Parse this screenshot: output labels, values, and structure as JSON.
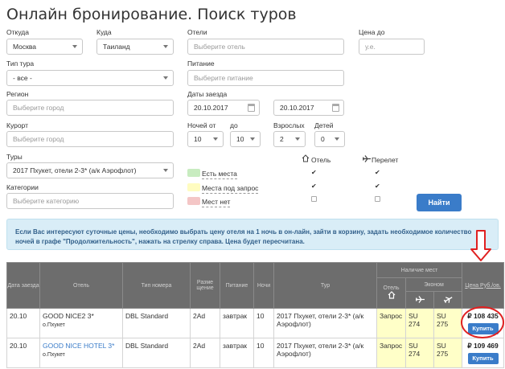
{
  "page_title": "Онлайн бронирование. Поиск туров",
  "form": {
    "from_label": "Откуда",
    "from_value": "Москва",
    "to_label": "Куда",
    "to_value": "Таиланд",
    "hotels_label": "Отели",
    "hotels_placeholder": "Выберите отель",
    "price_to_label": "Цена до",
    "price_to_placeholder": "у.е.",
    "tour_type_label": "Тип тура",
    "tour_type_value": "- все -",
    "meals_label": "Питание",
    "meals_placeholder": "Выберите питание",
    "region_label": "Регион",
    "region_placeholder": "Выберите город",
    "dates_label": "Даты заезда",
    "date_from": "20.10.2017",
    "date_to": "20.10.2017",
    "resort_label": "Курорт",
    "resort_placeholder": "Выберите город",
    "nights_from_label": "Ночей от",
    "nights_from_value": "10",
    "nights_to_label": "до",
    "nights_to_value": "10",
    "adults_label": "Взрослых",
    "adults_value": "2",
    "children_label": "Детей",
    "children_value": "0",
    "tours_label": "Туры",
    "tours_value": "2017 Пхукет, отели 2-3* (а/к Аэрофлот)",
    "categories_label": "Категории",
    "categories_placeholder": "Выберите категорию",
    "legend": [
      {
        "text": "Есть места",
        "color": "#c8ecc0"
      },
      {
        "text": "Места под запрос",
        "color": "#fffcc0"
      },
      {
        "text": "Мест нет",
        "color": "#f4c6c6"
      }
    ],
    "hotel_col_label": "Отель",
    "flight_col_label": "Перелет",
    "hotel_checks": [
      "✔",
      "✔",
      ""
    ],
    "flight_checks": [
      "✔",
      "✔",
      ""
    ],
    "search_button": "Найти"
  },
  "info_text": "Если Вас интересуют суточные цены, необходимо выбрать цену отеля на 1 ночь в он-лайн, зайти в корзину, задать необходимое количество ночей в графе \"Продолжительность\", нажать на стрелку справа. Цена будет пересчитана.",
  "table": {
    "headers": {
      "date": "Дата заезда",
      "hotel": "Отель",
      "room_type": "Тип номера",
      "placement": "Разме щение",
      "meals": "Питание",
      "nights": "Ночи",
      "tour": "Тур",
      "availability": "Наличие мест",
      "avail_hotel": "Отель",
      "economy": "Эконом",
      "price": "Цена Руб./ов."
    },
    "rows": [
      {
        "date": "20.10",
        "hotel": "GOOD NICE2 3*",
        "city": "о.Пхукет",
        "room": "DBL Standard",
        "placement": "2Ad",
        "meals": "завтрак",
        "nights": "10",
        "tour": "2017 Пхукет, отели 2-3* (а/к Аэрофлот)",
        "hotel_status": "Запрос",
        "flight1": "SU 274",
        "flight2": "SU 275",
        "price": "₽ 108 435",
        "buy": "Купить"
      },
      {
        "date": "20.10",
        "hotel": "GOOD NICE HOTEL 3*",
        "city": "о.Пхукет",
        "room": "DBL Standard",
        "placement": "2Ad",
        "meals": "завтрак",
        "nights": "10",
        "tour": "2017 Пхукет, отели 2-3* (а/к Аэрофлот)",
        "hotel_status": "Запрос",
        "flight1": "SU 274",
        "flight2": "SU 275",
        "price": "₽ 109 469",
        "buy": "Купить"
      }
    ]
  },
  "colors": {
    "accent": "#3a7cc9",
    "info_bg": "#d9edf7",
    "header_bg": "#6d6d6d",
    "request_bg": "#ffffc8",
    "annotation_red": "#e02020"
  }
}
